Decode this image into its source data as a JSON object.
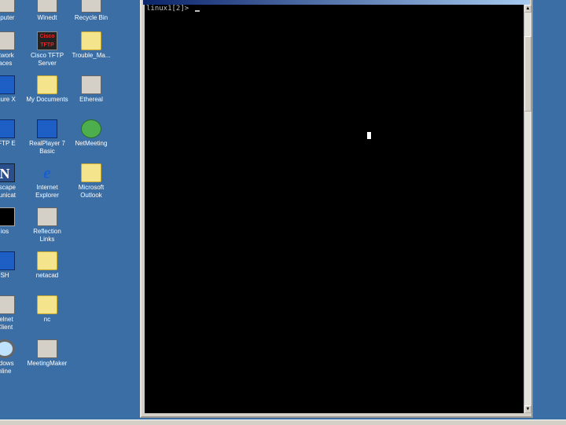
{
  "desktop": {
    "background": "#3a6ea5",
    "icons": [
      {
        "label": "mputer",
        "icon": "computer-icon"
      },
      {
        "label": "Winedt",
        "icon": "winedt-icon"
      },
      {
        "label": "Recycle Bin",
        "icon": "recycle-bin-icon"
      },
      {
        "label": "etwork\nlaces",
        "icon": "network-places-icon"
      },
      {
        "label": "Cisco TFTP\nServer",
        "icon": "cisco-tftp-icon",
        "badge": "Cisco\nTFTP"
      },
      {
        "label": "Trouble_Ma...",
        "icon": "folder-icon"
      },
      {
        "label": "ecure X",
        "icon": "secure-x-icon"
      },
      {
        "label": "My Documents",
        "icon": "my-documents-icon"
      },
      {
        "label": "Ethereal",
        "icon": "ethereal-icon"
      },
      {
        "label": "TFTP E",
        "icon": "tftp-icon"
      },
      {
        "label": "RealPlayer 7\nBasic",
        "icon": "realplayer-icon"
      },
      {
        "label": "NetMeeting",
        "icon": "netmeeting-icon"
      },
      {
        "label": "etscape\nmunicat",
        "icon": "netscape-icon",
        "glyph": "N"
      },
      {
        "label": "Internet\nExplorer",
        "icon": "internet-explorer-icon",
        "glyph": "e"
      },
      {
        "label": "Microsoft\nOutlook",
        "icon": "outlook-icon"
      },
      {
        "label": "ios",
        "icon": "terminal-icon"
      },
      {
        "label": "Reflection\nLinks",
        "icon": "reflection-icon"
      },
      {
        "label": "SH",
        "icon": "ssh-icon"
      },
      {
        "label": "netacad",
        "icon": "folder-icon"
      },
      {
        "label": "Telnet\nClient",
        "icon": "telnet-icon"
      },
      {
        "label": "nc",
        "icon": "nc-icon"
      },
      {
        "label": "ndows\nnline",
        "icon": "windows-online-icon"
      },
      {
        "label": "MeetingMaker",
        "icon": "meetingmaker-icon"
      }
    ]
  },
  "console": {
    "prompt": "linux1[2]> ",
    "screen_color": "#000000",
    "text_color": "#c0c0c0",
    "scroll_up": "▲",
    "scroll_down": "▼"
  }
}
